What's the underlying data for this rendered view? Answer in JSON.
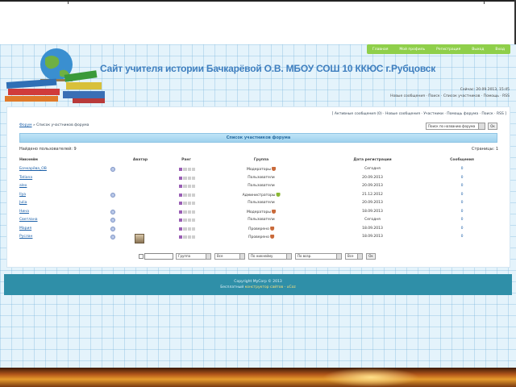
{
  "top_nav": {
    "items": [
      "Главная",
      "Мой профиль",
      "Регистрация",
      "Выход",
      "Вход"
    ]
  },
  "header": {
    "site_title": "Сайт учителя истории Бачкарёвой О.В. МБОУ СОШ 10 ККЮС г.Рубцовск",
    "info_line1": "Сейчас: 20.09.2013, 15:45",
    "info_line2": "Новые сообщения · Поиск · Список участников · Помощь · RSS"
  },
  "panel_links": "[ Активные сообщения (0) · Новые сообщения · Участники · Помощь форума · Поиск · RSS ]",
  "breadcrumb": {
    "home": "Форум",
    "current": "» Список участников форума"
  },
  "forum_jump": {
    "placeholder": "Поиск по названию форума",
    "go": "Ок"
  },
  "list": {
    "title": "Список участников форума",
    "found_label": "Найдено пользователей: 9",
    "pages_label": "Страницы: 1"
  },
  "table": {
    "columns": [
      "Никнейм",
      "Аватар",
      "Ранг",
      "Группа",
      "Дата регистрации",
      "Сообщения"
    ],
    "rows": [
      {
        "name": "Бачкарёва_ОВ",
        "gear": true,
        "rank": 1,
        "group": "Модераторы",
        "shield": "orange",
        "date": "Сегодня",
        "posts": "0"
      },
      {
        "name": "Tatiana",
        "gear": false,
        "rank": 1,
        "group": "Пользователи",
        "shield": "",
        "date": "20.09.2013",
        "posts": "0"
      },
      {
        "name": "alex",
        "gear": false,
        "rank": 1,
        "group": "Пользователи",
        "shield": "",
        "date": "20.09.2013",
        "posts": "0"
      },
      {
        "name": "Ilya",
        "gear": true,
        "rank": 1,
        "group": "Администраторы",
        "shield": "green",
        "date": "21.12.2012",
        "posts": "0"
      },
      {
        "name": "Julia",
        "gear": false,
        "rank": 1,
        "group": "Пользователи",
        "shield": "",
        "date": "20.09.2013",
        "posts": "0"
      },
      {
        "name": "Нина",
        "gear": true,
        "rank": 1,
        "group": "Модераторы",
        "shield": "orange",
        "date": "18.09.2013",
        "posts": "0"
      },
      {
        "name": "Светлана",
        "gear": true,
        "rank": 1,
        "group": "Пользователи",
        "shield": "",
        "date": "Сегодня",
        "posts": "0"
      },
      {
        "name": "Мария",
        "gear": true,
        "rank": 1,
        "group": "Проверено",
        "shield": "orange",
        "date": "18.09.2013",
        "posts": "0"
      },
      {
        "name": "Руслан",
        "gear": true,
        "rank": 1,
        "group": "Проверено",
        "shield": "orange",
        "date": "18.09.2013",
        "posts": "0",
        "avatar": true
      }
    ]
  },
  "filter": {
    "sel1": "Группа",
    "sel2": "Все",
    "sel3": "По никнейму",
    "sel4": "По возр.",
    "sel5": "Все",
    "go": "Ок"
  },
  "footer": {
    "copyright": "Copyright MyCorp © 2013",
    "hosted_prefix": "Бесплатный",
    "hosted_link": "конструктор сайтов - uCoz"
  },
  "colors": {
    "accent": "#3f7fbf",
    "nav_green": "#8fcf4a",
    "footer_teal": "#2f8fa8",
    "link": "#1a5fa8"
  }
}
